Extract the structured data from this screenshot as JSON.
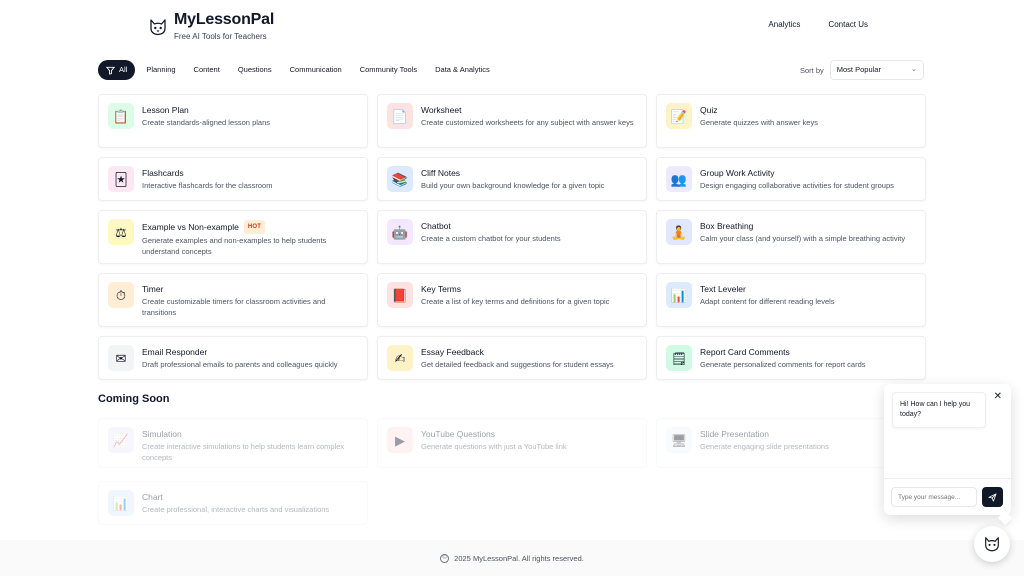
{
  "header": {
    "brand": "MyLessonPal",
    "tagline": "Free AI Tools for Teachers",
    "nav": [
      "Analytics",
      "Contact Us"
    ],
    "logo_icon": "cat-face-icon"
  },
  "filters": {
    "chips": [
      "All",
      "Planning",
      "Content",
      "Questions",
      "Communication",
      "Community Tools",
      "Data & Analytics"
    ],
    "active": "All",
    "sort_label": "Sort by",
    "sort_value": "Most Popular"
  },
  "tools": [
    {
      "title": "Lesson Plan",
      "desc": "Create standards-aligned lesson plans",
      "icon": "lesson-plan-icon",
      "glyph": "📋",
      "bg": "#dcfce7"
    },
    {
      "title": "Worksheet",
      "desc": "Create customized worksheets for any subject with answer keys",
      "icon": "worksheet-icon",
      "glyph": "📄",
      "bg": "#fde2e2"
    },
    {
      "title": "Quiz",
      "desc": "Generate quizzes with answer keys",
      "icon": "quiz-icon",
      "glyph": "📝",
      "bg": "#fef3c7"
    },
    {
      "title": "Flashcards",
      "desc": "Interactive flashcards for the classroom",
      "icon": "flashcards-icon",
      "glyph": "🃏",
      "bg": "#fce7f3"
    },
    {
      "title": "Cliff Notes",
      "desc": "Build your own background knowledge for a given topic",
      "icon": "cliff-notes-icon",
      "glyph": "📚",
      "bg": "#dbeafe"
    },
    {
      "title": "Group Work Activity",
      "desc": "Design engaging collaborative activities for student groups",
      "icon": "group-work-icon",
      "glyph": "👥",
      "bg": "#ede9fe"
    },
    {
      "title": "Example vs Non-example",
      "badge": "HOT",
      "desc": "Generate examples and non-examples to help students understand concepts",
      "icon": "example-icon",
      "glyph": "⚖",
      "bg": "#fef9c3"
    },
    {
      "title": "Chatbot",
      "desc": "Create a custom chatbot for your students",
      "icon": "chatbot-icon",
      "glyph": "🤖",
      "bg": "#f3e8ff"
    },
    {
      "title": "Box Breathing",
      "desc": "Calm your class (and yourself) with a simple breathing activity",
      "icon": "box-breathing-icon",
      "glyph": "🧘",
      "bg": "#e0e7ff"
    },
    {
      "title": "Timer",
      "desc": "Create customizable timers for classroom activities and transitions",
      "icon": "timer-icon",
      "glyph": "⏱",
      "bg": "#ffedd5"
    },
    {
      "title": "Key Terms",
      "desc": "Create a list of key terms and definitions for a given topic",
      "icon": "key-terms-icon",
      "glyph": "📕",
      "bg": "#fee2e2"
    },
    {
      "title": "Text Leveler",
      "desc": "Adapt content for different reading levels",
      "icon": "text-leveler-icon",
      "glyph": "📊",
      "bg": "#dbeafe"
    },
    {
      "title": "Email Responder",
      "desc": "Draft professional emails to parents and colleagues quickly",
      "icon": "email-icon",
      "glyph": "✉",
      "bg": "#f3f4f6"
    },
    {
      "title": "Essay Feedback",
      "desc": "Get detailed feedback and suggestions for student essays",
      "icon": "essay-feedback-icon",
      "glyph": "✍",
      "bg": "#fef3c7"
    },
    {
      "title": "Report Card Comments",
      "desc": "Generate personalized comments for report cards",
      "icon": "report-card-icon",
      "glyph": "🗒",
      "bg": "#d1fae5"
    }
  ],
  "coming_soon": {
    "title": "Coming Soon",
    "tools": [
      {
        "title": "Simulation",
        "desc": "Create interactive simulations to help students learn complex concepts",
        "icon": "simulation-icon",
        "glyph": "📈",
        "bg": "#ede9fe"
      },
      {
        "title": "YouTube Questions",
        "desc": "Generate questions with just a YouTube link",
        "icon": "youtube-icon",
        "glyph": "▶",
        "bg": "#fee2e2"
      },
      {
        "title": "Slide Presentation",
        "desc": "Generate engaging slide presentations",
        "icon": "slides-icon",
        "glyph": "🖥",
        "bg": "#f3f4f6"
      },
      {
        "title": "Chart",
        "desc": "Create professional, interactive charts and visualizations",
        "icon": "chart-icon",
        "glyph": "📊",
        "bg": "#dbeafe"
      }
    ]
  },
  "footer": {
    "text": "2025 MyLessonPal. All rights reserved."
  },
  "chat": {
    "greeting": "Hi! How can I help you today?",
    "placeholder": "Type your message..."
  }
}
